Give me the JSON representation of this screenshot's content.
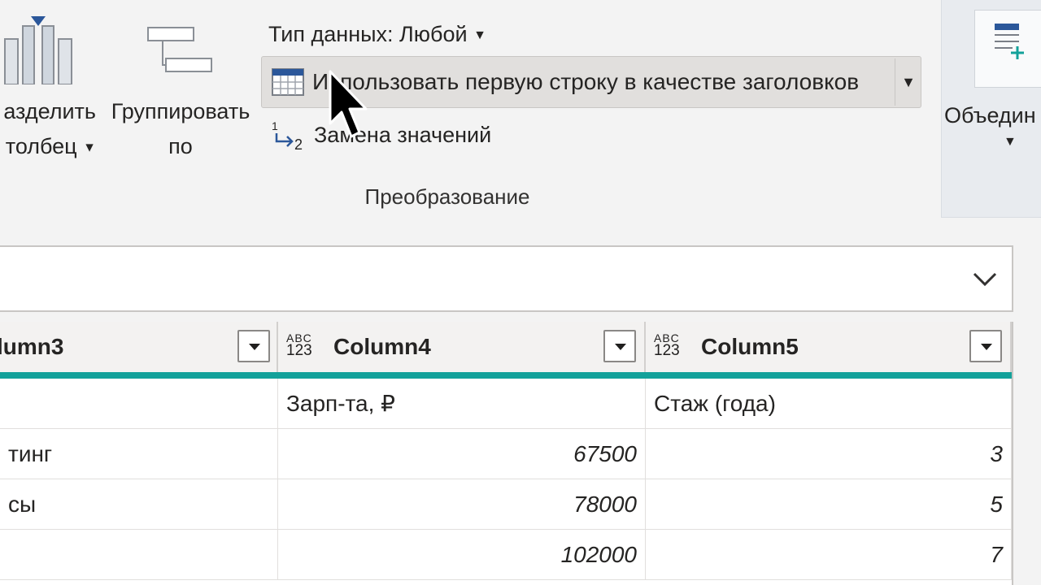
{
  "ribbon": {
    "split_column": {
      "line1": "азделить",
      "line2": "толбец"
    },
    "group_by": {
      "line1": "Группировать",
      "line2": "по"
    },
    "data_type": {
      "label": "Тип данных: Любой"
    },
    "first_row_headers": {
      "label": "Использовать первую строку в качестве заголовков"
    },
    "replace_values": {
      "label": "Замена значений"
    },
    "group_title": "Преобразование",
    "merge": {
      "label": "Объедин"
    }
  },
  "formula_bar": {
    "value": ""
  },
  "grid": {
    "columns": [
      {
        "name": "lumn3",
        "type_top": "ABC",
        "type_bottom": "123"
      },
      {
        "name": "Column4",
        "type_top": "ABC",
        "type_bottom": "123"
      },
      {
        "name": "Column5",
        "type_top": "ABC",
        "type_bottom": "123"
      }
    ],
    "rows": [
      [
        "",
        "Зарп-та, ₽",
        "Стаж (года)"
      ],
      [
        "тинг",
        "67500",
        "3"
      ],
      [
        "сы",
        "78000",
        "5"
      ],
      [
        "",
        "102000",
        "7"
      ]
    ]
  },
  "colors": {
    "accent": "#12a19a",
    "selected_bg": "#e1dfdd",
    "ribbon_bg": "#f3f3f3"
  },
  "icons": {
    "split": "split-column-icon",
    "group": "group-by-icon",
    "table": "table-header-icon",
    "replace": "replace-values-icon",
    "merge": "merge-queries-icon",
    "expand": "chevron-down-icon",
    "cursor": "mouse-pointer-icon"
  }
}
